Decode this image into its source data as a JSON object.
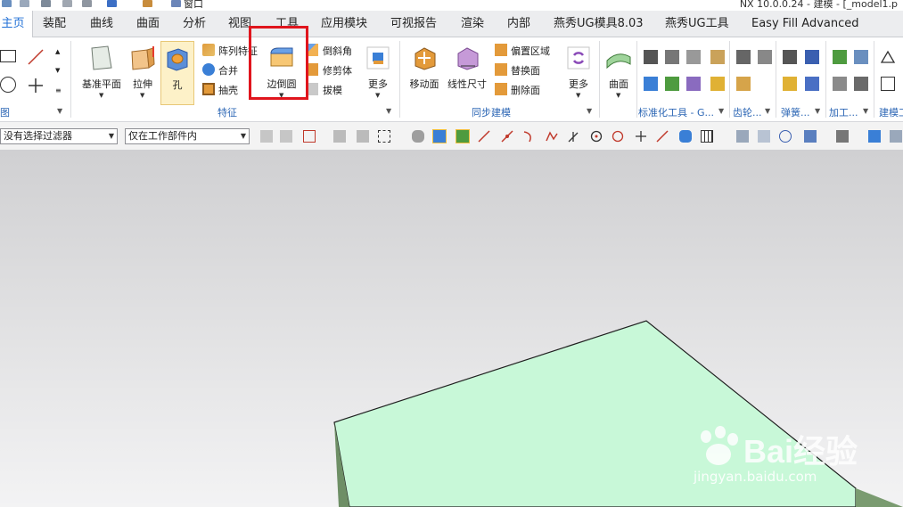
{
  "window": {
    "title": "NX 10.0.0.24 - 建模 - [_model1.p"
  },
  "quick_access": {
    "window_menu": "窗口"
  },
  "tabs": [
    {
      "label": "主页",
      "active": true
    },
    {
      "label": "装配"
    },
    {
      "label": "曲线"
    },
    {
      "label": "曲面"
    },
    {
      "label": "分析"
    },
    {
      "label": "视图"
    },
    {
      "label": "工具"
    },
    {
      "label": "应用模块"
    },
    {
      "label": "可视报告"
    },
    {
      "label": "渲染"
    },
    {
      "label": "内部"
    },
    {
      "label": "燕秀UG模具8.03"
    },
    {
      "label": "燕秀UG工具"
    },
    {
      "label": "Easy Fill Advanced"
    }
  ],
  "ribbon": {
    "sketch_group_label": "图",
    "feature": {
      "datum_plane": "基准平面",
      "extrude": "拉伸",
      "hole": "孔",
      "pattern": "阵列特征",
      "unite": "合并",
      "shell": "抽壳",
      "edge_blend": "边倒圆",
      "chamfer": "倒斜角",
      "trim": "修剪体",
      "draft": "拔模",
      "more": "更多",
      "label": "特征"
    },
    "sync": {
      "move_face": "移动面",
      "linear_dim": "线性尺寸",
      "offset_region": "偏置区域",
      "replace_face": "替换面",
      "delete_face": "删除面",
      "more": "更多",
      "label": "同步建模"
    },
    "surface": {
      "label": "曲面"
    },
    "small_groups": [
      "标准化工具 - G...",
      "齿轮...",
      "弹簧...",
      "加工...",
      "建模工..."
    ]
  },
  "selection": {
    "filter": "没有选择过滤器",
    "scope": "仅在工作部件内"
  },
  "watermark": {
    "text": "Bai经验",
    "url": "jingyan.baidu.com"
  },
  "colors": {
    "accent": "#1f6fd6",
    "part": "#c8f8d8",
    "highlight": "#e0151d"
  }
}
